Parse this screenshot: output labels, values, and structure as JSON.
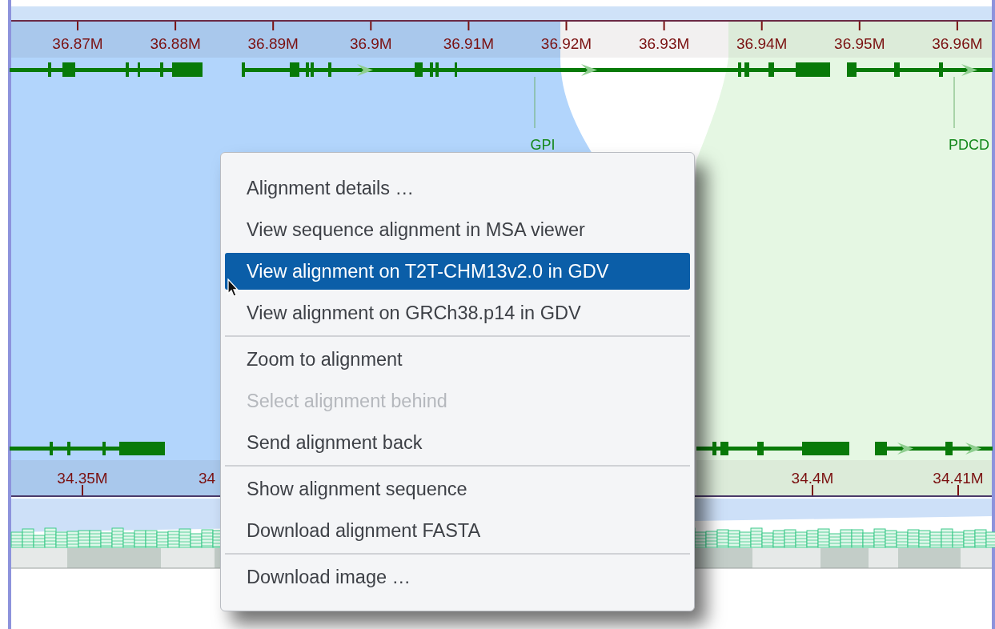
{
  "top_ruler": {
    "ticks": [
      "36.87M",
      "36.88M",
      "36.89M",
      "36.9M",
      "36.91M",
      "36.92M",
      "36.93M",
      "36.94M",
      "36.95M",
      "36.96M"
    ]
  },
  "gene_labels": [
    "GPI",
    "PDCD"
  ],
  "bottom_ruler": {
    "ticks": [
      "34.35M",
      "34",
      "34.4M",
      "34.41M"
    ]
  },
  "context_menu": {
    "sections": [
      [
        {
          "label": "Alignment details …",
          "selected": false,
          "disabled": false
        },
        {
          "label": "View sequence alignment in MSA viewer",
          "selected": false,
          "disabled": false
        },
        {
          "label": "View alignment on T2T-CHM13v2.0 in GDV",
          "selected": true,
          "disabled": false
        },
        {
          "label": "View alignment on GRCh38.p14 in GDV",
          "selected": false,
          "disabled": false
        }
      ],
      [
        {
          "label": "Zoom to alignment",
          "selected": false,
          "disabled": false
        },
        {
          "label": "Select alignment behind",
          "selected": false,
          "disabled": true
        },
        {
          "label": "Send alignment back",
          "selected": false,
          "disabled": false
        }
      ],
      [
        {
          "label": "Show alignment sequence",
          "selected": false,
          "disabled": false
        },
        {
          "label": "Download alignment FASTA",
          "selected": false,
          "disabled": false
        }
      ],
      [
        {
          "label": "Download image …",
          "selected": false,
          "disabled": false
        }
      ]
    ]
  }
}
